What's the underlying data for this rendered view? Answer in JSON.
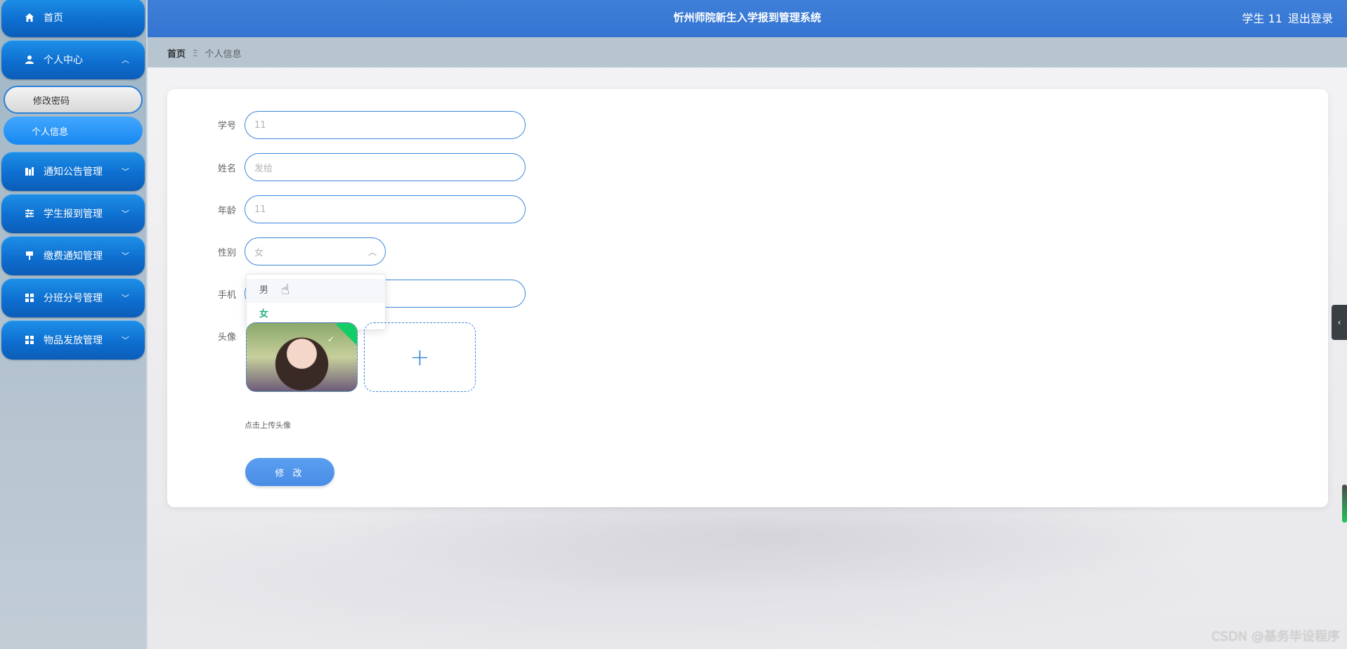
{
  "header": {
    "title": "忻州师院新生入学报到管理系统",
    "user": "学生 11",
    "logout": "退出登录"
  },
  "breadcrumb": {
    "home": "首页",
    "separator": "Ξ",
    "current": "个人信息"
  },
  "sidebar": {
    "items": [
      {
        "label": "首页",
        "icon": "home-icon"
      },
      {
        "label": "个人中心",
        "icon": "user-icon",
        "chevron": "^",
        "children": [
          {
            "label": "修改密码"
          },
          {
            "label": "个人信息"
          }
        ]
      },
      {
        "label": "通知公告管理",
        "icon": "building-icon",
        "chevron": "⌄"
      },
      {
        "label": "学生报到管理",
        "icon": "sliders-icon",
        "chevron": "⌄"
      },
      {
        "label": "缴费通知管理",
        "icon": "brush-icon",
        "chevron": "⌄"
      },
      {
        "label": "分班分号管理",
        "icon": "grid-icon",
        "chevron": "⌄"
      },
      {
        "label": "物品发放管理",
        "icon": "grid-icon",
        "chevron": "⌄"
      }
    ]
  },
  "form": {
    "student_id": {
      "label": "学号",
      "value": "11"
    },
    "name": {
      "label": "姓名",
      "value": "发给"
    },
    "age": {
      "label": "年龄",
      "value": "11"
    },
    "gender": {
      "label": "性别",
      "value": "女",
      "options": [
        "男",
        "女"
      ]
    },
    "phone": {
      "label": "手机",
      "value": ""
    },
    "avatar": {
      "label": "头像",
      "tip": "点击上传头像"
    },
    "submit_label": "修 改"
  },
  "colors": {
    "primary": "#3575d2",
    "accent": "#1688f0",
    "selected": "#22b07f"
  },
  "watermark": "CSDN @基务毕设程序"
}
